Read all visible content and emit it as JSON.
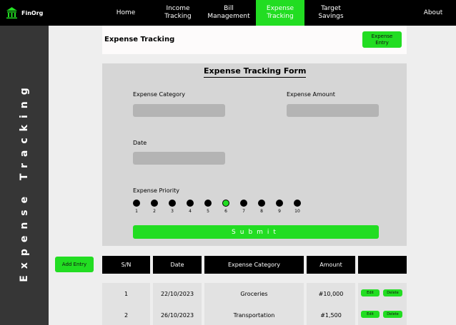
{
  "app": {
    "logo_text": "FinOrg",
    "logo_icon": "bank-icon"
  },
  "nav": {
    "home": "Home",
    "income": "Income\nTracking",
    "bill": "Bill\nManagement",
    "expense": "Expense\nTracking",
    "target": "Target\nSavings",
    "about": "About"
  },
  "sidebar": {
    "title": "Expense Tracking"
  },
  "header": {
    "title": "Expense Tracking",
    "button": "Expense\nEntry"
  },
  "form": {
    "title": "Expense Tracking Form",
    "category_label": "Expense Category",
    "category_value": "",
    "amount_label": "Expense Amount",
    "amount_value": "",
    "date_label": "Date",
    "date_value": "",
    "priority_label": "Expense Priority",
    "priorities": [
      "1",
      "2",
      "3",
      "4",
      "5",
      "6",
      "7",
      "8",
      "9",
      "10"
    ],
    "selected_priority": "6",
    "submit": "Submit"
  },
  "add_entry": "Add Entry",
  "table": {
    "headers": [
      "S/N",
      "Date",
      "Expense Category",
      "Amount",
      ""
    ],
    "rows": [
      {
        "sn": "1",
        "date": "22/10/2023",
        "category": "Groceries",
        "amount": "#10,000",
        "edit": "Edit",
        "delete": "Delete"
      },
      {
        "sn": "2",
        "date": "26/10/2023",
        "category": "Transportation",
        "amount": "#1,500",
        "edit": "Edit",
        "delete": "Delete"
      }
    ]
  },
  "colors": {
    "accent": "#22dd22",
    "nav_bg": "#000000",
    "sidebar_bg": "#363636",
    "form_bg": "#d6d6d6",
    "input_bg": "#b4b4b4"
  }
}
